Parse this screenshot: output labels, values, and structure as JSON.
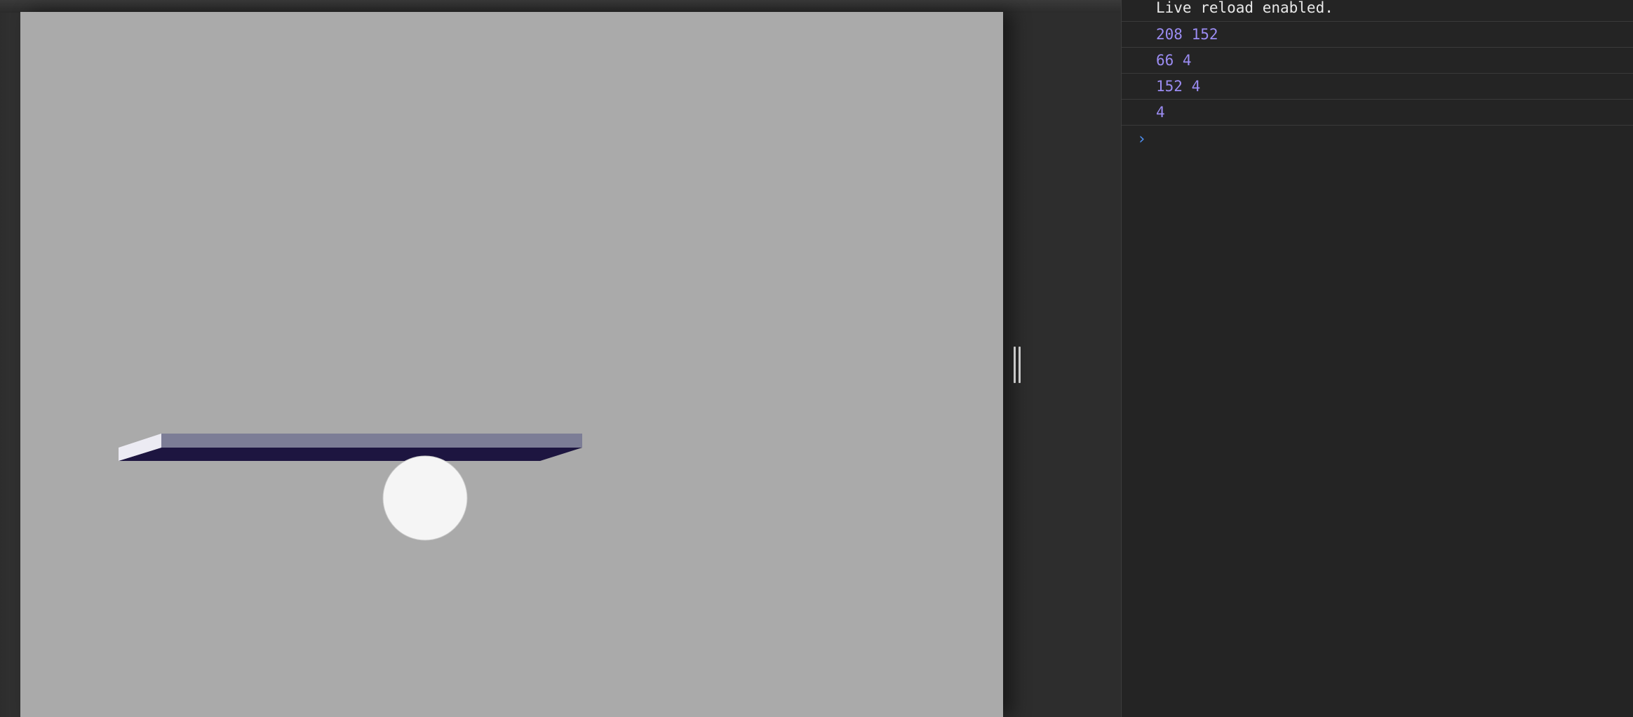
{
  "console": {
    "messages": [
      {
        "text": "Live reload enabled.",
        "kind": "info"
      },
      {
        "text": "208 152",
        "kind": "log"
      },
      {
        "text": "66 4",
        "kind": "log"
      },
      {
        "text": "152 4",
        "kind": "log"
      },
      {
        "text": "4",
        "kind": "log"
      }
    ],
    "prompt_glyph": "›"
  },
  "scene": {
    "background": "#aaaaaa",
    "platform_top_color": "#7c7d96",
    "platform_side_color": "#1d1540",
    "platform_end_color": "#ecebf3",
    "ball_color": "#f5f5f5"
  },
  "colors": {
    "console_bg": "#242424",
    "log_text": "#9b8cf2",
    "info_text": "#e8e8e8",
    "prompt": "#4f8ff0"
  }
}
